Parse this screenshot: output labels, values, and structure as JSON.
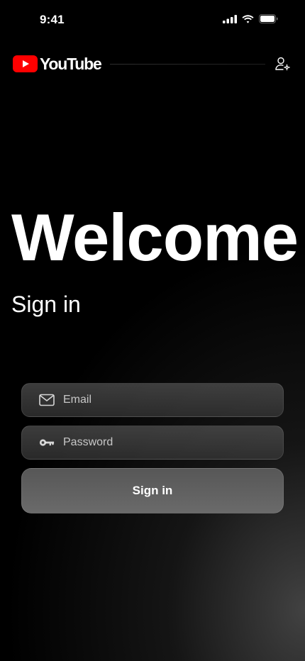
{
  "status_bar": {
    "time": "9:41",
    "icons": [
      "signal-icon",
      "wifi-icon",
      "battery-icon"
    ]
  },
  "header": {
    "logo_text": "YouTube",
    "logo_color": "#FF0000",
    "account_icon": "account-settings-icon"
  },
  "main": {
    "title": "Welcome",
    "subtitle": "Sign in"
  },
  "form": {
    "email": {
      "placeholder": "Email",
      "value": "",
      "icon": "mail-icon"
    },
    "password": {
      "placeholder": "Password",
      "value": "",
      "icon": "key-icon"
    },
    "submit_label": "Sign in"
  }
}
